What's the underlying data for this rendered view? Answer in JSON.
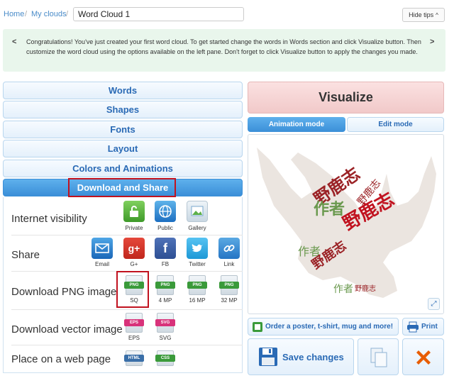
{
  "breadcrumb": {
    "home": "Home",
    "sep1": "/",
    "my_clouds": "My clouds",
    "sep2": "/"
  },
  "cloud_title": "Word Cloud 1",
  "hide_tips": {
    "label": "Hide tips",
    "chevron": "^"
  },
  "tips": {
    "prev_arrow": "<",
    "next_arrow": ">",
    "text": "Congratulations! You've just created your first word cloud. To get started change the words in Words section and click Visualize button. Then customize the word cloud using the options available on the left pane. Don't forget to click Visualize button to apply the changes you made."
  },
  "accordion": [
    {
      "label": "Words"
    },
    {
      "label": "Shapes"
    },
    {
      "label": "Fonts"
    },
    {
      "label": "Layout"
    },
    {
      "label": "Colors and Animations"
    },
    {
      "label": "Download and Share"
    }
  ],
  "download_share": {
    "visibility": {
      "label": "Internet visibility",
      "options": [
        {
          "caption": "Private",
          "icon": "lock-icon"
        },
        {
          "caption": "Public",
          "icon": "globe-icon"
        },
        {
          "caption": "Gallery",
          "icon": "gallery-icon"
        }
      ]
    },
    "share": {
      "label": "Share",
      "options": [
        {
          "caption": "Email",
          "icon": "envelope-icon"
        },
        {
          "caption": "G+",
          "icon": "google-plus-icon",
          "glyph": "g+"
        },
        {
          "caption": "FB",
          "icon": "facebook-icon",
          "glyph": "f"
        },
        {
          "caption": "Twitter",
          "icon": "twitter-icon"
        },
        {
          "caption": "Link",
          "icon": "link-icon"
        }
      ]
    },
    "png": {
      "label": "Download PNG image",
      "options": [
        {
          "tag": "PNG",
          "caption": "SQ"
        },
        {
          "tag": "PNG",
          "caption": "4 MP"
        },
        {
          "tag": "PNG",
          "caption": "16 MP"
        },
        {
          "tag": "PNG",
          "caption": "32 MP"
        }
      ]
    },
    "vector": {
      "label": "Download vector image",
      "options": [
        {
          "tag": "EPS",
          "caption": "EPS"
        },
        {
          "tag": "SVG",
          "caption": "SVG"
        }
      ]
    },
    "web": {
      "label": "Place on a web page",
      "options": [
        {
          "tag": "HTML"
        },
        {
          "tag": "CSS"
        }
      ]
    }
  },
  "visualize_label": "Visualize",
  "modes": {
    "animation": "Animation mode",
    "edit": "Edit mode"
  },
  "cloud_words": [
    "野鹿志",
    "作者",
    "野鹿志",
    "野鹿志",
    "作者",
    "野鹿志",
    "作者",
    "野鹿志"
  ],
  "order_label": "Order a poster, t-shirt, mug and more!",
  "print_label": "Print",
  "save_label": "Save changes",
  "colors": {
    "accent": "#3b8fd8",
    "highlight": "#c1121f",
    "png_green": "#3a9a3a",
    "eps_pink": "#d8327a"
  }
}
